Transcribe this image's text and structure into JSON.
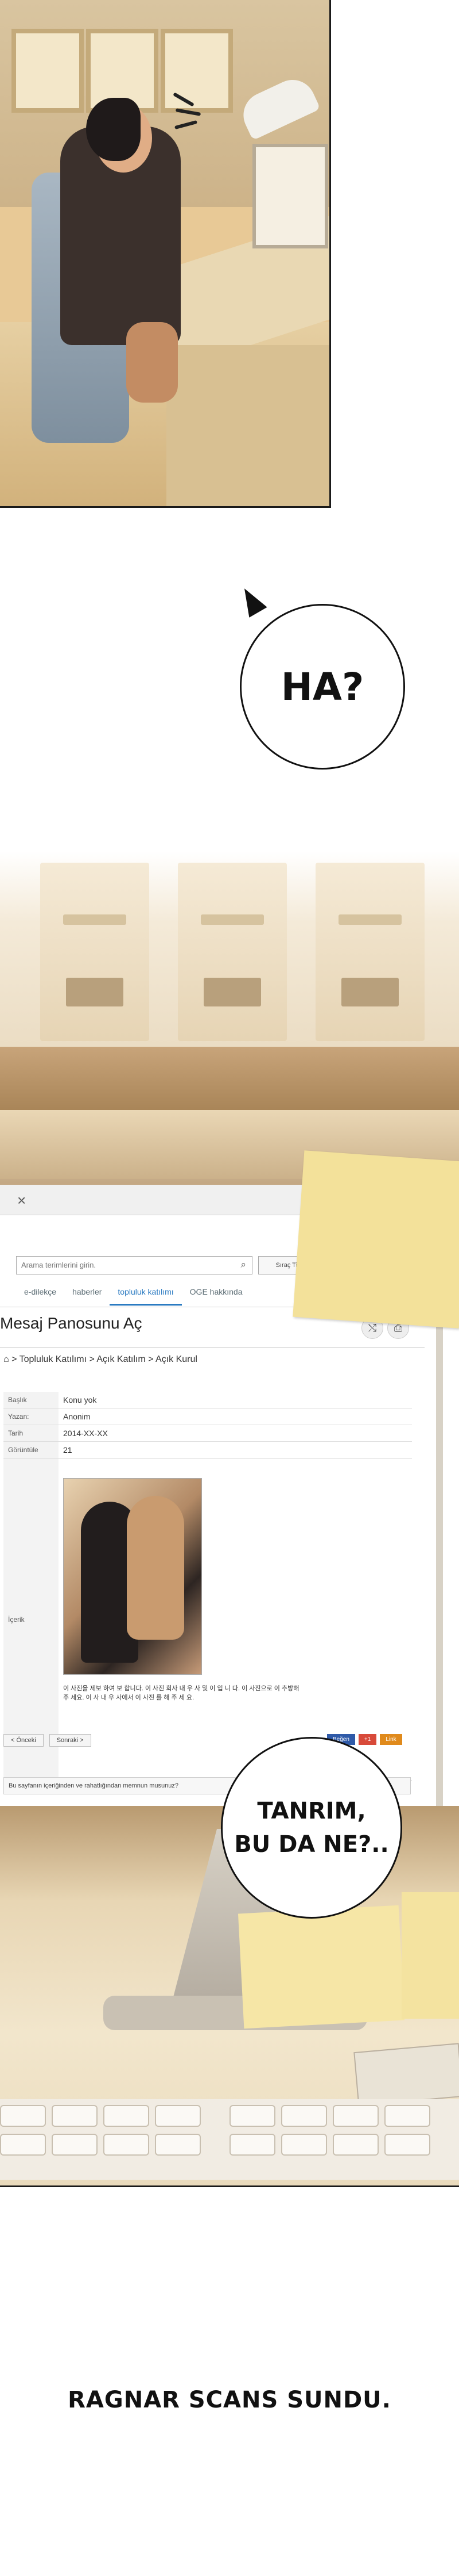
{
  "bubbles": {
    "first": "HA?",
    "second_line1": "TANRIM,",
    "second_line2": "BU DA NE?.."
  },
  "screen": {
    "tab_close": "×",
    "search_placeholder": "Arama terimlerini girin.",
    "search_button": "Sıraç Tipi Arama",
    "nav": [
      "e-dilekçe",
      "haberler",
      "topluluk katılımı",
      "OGE hakkında"
    ],
    "page_title": "Mesaj Panosunu Aç",
    "breadcrumb": "⌂ > Topluluk Katılımı > Açık Katılım > Açık Kurul",
    "table": {
      "rows": [
        {
          "key": "Başlık",
          "value": "Konu yok"
        },
        {
          "key": "Yazan:",
          "value": "Anonim"
        },
        {
          "key": "Tarih",
          "value": "2014-XX-XX"
        },
        {
          "key": "Görüntüle",
          "value": "21"
        }
      ],
      "content_label": "İçerik"
    },
    "caption": "이 사진을 제보 하여 보 합니다. 이 사진 회사 내 우 사 및 이 입 니 다. 이 사진으로 이 추방해 주 세요. 이 사 내 우 사에서 이 사진 를 해 주 세 요.",
    "pager": {
      "prev": "< Önceki",
      "next": "Sonraki >"
    },
    "socials": [
      {
        "label": "Beğen",
        "color": "#2f5aa8"
      },
      {
        "label": "+1",
        "color": "#d84a3a"
      },
      {
        "label": "Link",
        "color": "#e08a1c"
      }
    ],
    "question": "Bu sayfanın içeriğinden ve rahatlığından memnun musunuz?"
  },
  "credits": "RAGNAR SCANS SUNDU."
}
